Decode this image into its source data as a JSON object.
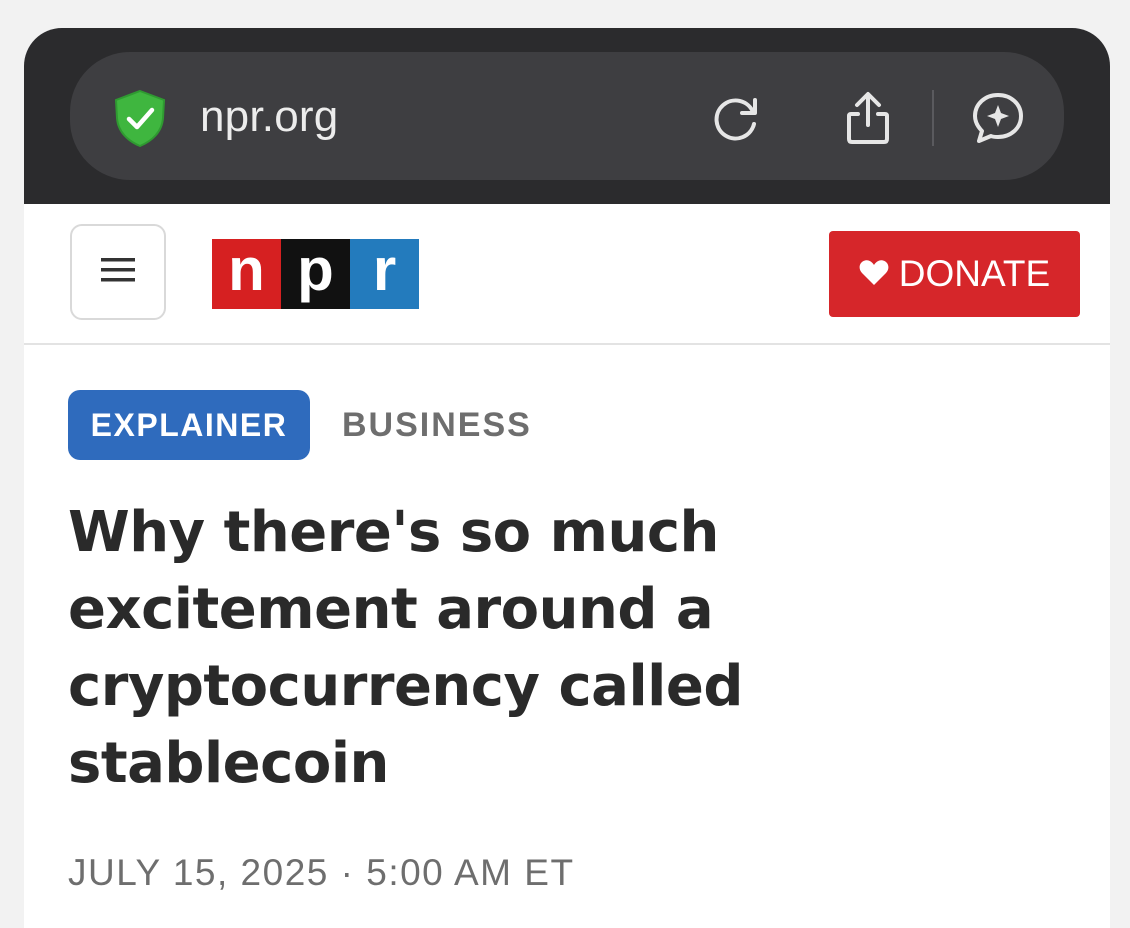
{
  "browser": {
    "url": "npr.org",
    "icons": {
      "security": "shield-check-icon",
      "reload": "reload-icon",
      "share": "share-icon",
      "assistant": "ai-chat-icon"
    }
  },
  "header": {
    "menu_icon": "hamburger-menu-icon",
    "logo_letters": [
      "n",
      "p",
      "r"
    ],
    "logo_colors": [
      "#d62021",
      "#111111",
      "#237bbd"
    ],
    "donate_label": "DONATE",
    "donate_icon": "heart-icon",
    "donate_color": "#d6262a"
  },
  "article": {
    "badge": "EXPLAINER",
    "badge_color": "#2f6bbd",
    "section": "BUSINESS",
    "headline": "Why there's so much excitement around a cryptocurrency called stablecoin",
    "dateline": "JULY 15, 2025 · 5:00 AM ET"
  }
}
